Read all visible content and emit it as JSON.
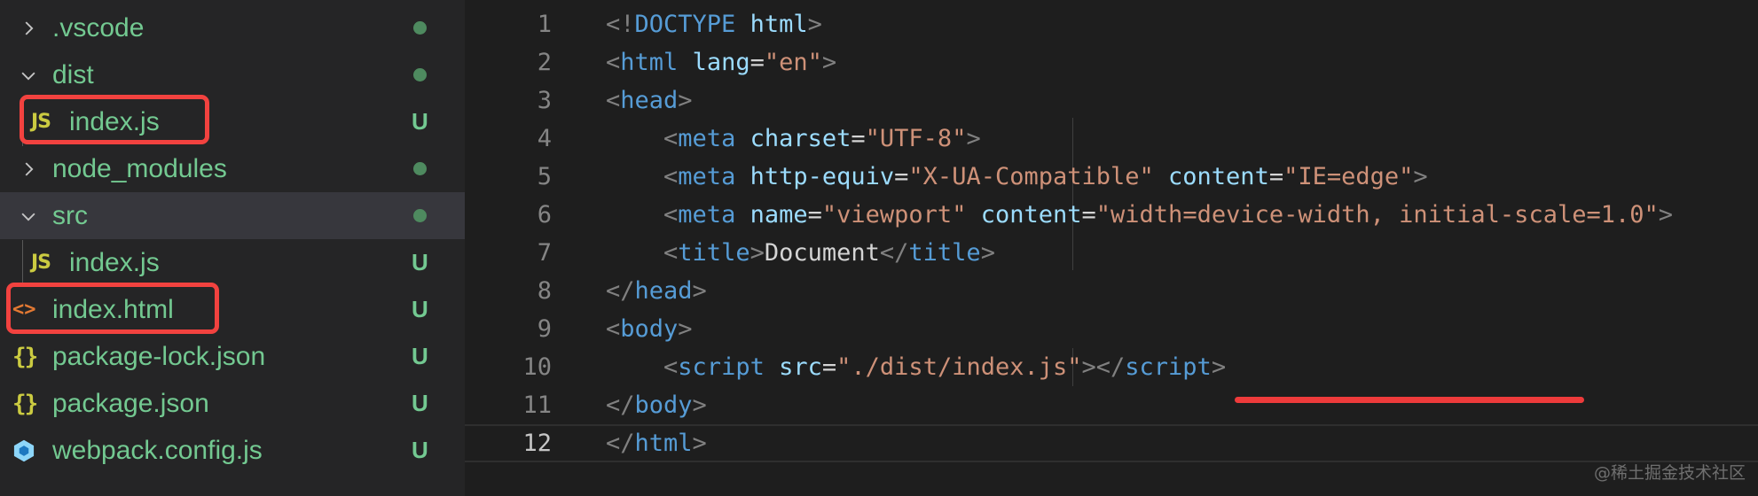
{
  "explorer": {
    "items": [
      {
        "label": ".vscode",
        "kind": "folder",
        "expanded": false,
        "badge": ""
      },
      {
        "label": "dist",
        "kind": "folder",
        "expanded": true,
        "badge": ""
      },
      {
        "label": "index.js",
        "kind": "js",
        "badge": "U"
      },
      {
        "label": "node_modules",
        "kind": "folder",
        "expanded": false,
        "badge": ""
      },
      {
        "label": "src",
        "kind": "folder",
        "expanded": true,
        "badge": ""
      },
      {
        "label": "index.js",
        "kind": "js",
        "badge": "U"
      },
      {
        "label": "index.html",
        "kind": "html",
        "badge": "U"
      },
      {
        "label": "package-lock.json",
        "kind": "json",
        "badge": "U"
      },
      {
        "label": "package.json",
        "kind": "json",
        "badge": "U"
      },
      {
        "label": "webpack.config.js",
        "kind": "webpack",
        "badge": "U"
      }
    ],
    "icons": {
      "js": "JS",
      "html": "<>",
      "json": "{}"
    }
  },
  "editor": {
    "line_numbers": [
      "1",
      "2",
      "3",
      "4",
      "5",
      "6",
      "7",
      "8",
      "9",
      "10",
      "11",
      "12"
    ],
    "current_line": "12",
    "lines": [
      [
        [
          "punc",
          "<!"
        ],
        [
          "tag",
          "DOCTYPE"
        ],
        [
          "text",
          " "
        ],
        [
          "attr",
          "html"
        ],
        [
          "punc",
          ">"
        ]
      ],
      [
        [
          "punc",
          "<"
        ],
        [
          "tag",
          "html"
        ],
        [
          "text",
          " "
        ],
        [
          "attr",
          "lang"
        ],
        [
          "text",
          "="
        ],
        [
          "str",
          "\"en\""
        ],
        [
          "punc",
          ">"
        ]
      ],
      [
        [
          "punc",
          "<"
        ],
        [
          "tag",
          "head"
        ],
        [
          "punc",
          ">"
        ]
      ],
      [
        [
          "text",
          "    "
        ],
        [
          "punc",
          "<"
        ],
        [
          "tag",
          "meta"
        ],
        [
          "text",
          " "
        ],
        [
          "attr",
          "charset"
        ],
        [
          "text",
          "="
        ],
        [
          "str",
          "\"UTF-8\""
        ],
        [
          "punc",
          ">"
        ]
      ],
      [
        [
          "text",
          "    "
        ],
        [
          "punc",
          "<"
        ],
        [
          "tag",
          "meta"
        ],
        [
          "text",
          " "
        ],
        [
          "attr",
          "http-equiv"
        ],
        [
          "text",
          "="
        ],
        [
          "str",
          "\"X-UA-Compatible\""
        ],
        [
          "text",
          " "
        ],
        [
          "attr",
          "content"
        ],
        [
          "text",
          "="
        ],
        [
          "str",
          "\"IE=edge\""
        ],
        [
          "punc",
          ">"
        ]
      ],
      [
        [
          "text",
          "    "
        ],
        [
          "punc",
          "<"
        ],
        [
          "tag",
          "meta"
        ],
        [
          "text",
          " "
        ],
        [
          "attr",
          "name"
        ],
        [
          "text",
          "="
        ],
        [
          "str",
          "\"viewport\""
        ],
        [
          "text",
          " "
        ],
        [
          "attr",
          "content"
        ],
        [
          "text",
          "="
        ],
        [
          "str",
          "\"width=device-width, initial-scale=1.0\""
        ],
        [
          "punc",
          ">"
        ]
      ],
      [
        [
          "text",
          "    "
        ],
        [
          "punc",
          "<"
        ],
        [
          "tag",
          "title"
        ],
        [
          "punc",
          ">"
        ],
        [
          "text",
          "Document"
        ],
        [
          "punc",
          "</"
        ],
        [
          "tag",
          "title"
        ],
        [
          "punc",
          ">"
        ]
      ],
      [
        [
          "punc",
          "</"
        ],
        [
          "tag",
          "head"
        ],
        [
          "punc",
          ">"
        ]
      ],
      [
        [
          "punc",
          "<"
        ],
        [
          "tag",
          "body"
        ],
        [
          "punc",
          ">"
        ]
      ],
      [
        [
          "text",
          "    "
        ],
        [
          "punc",
          "<"
        ],
        [
          "tag",
          "script"
        ],
        [
          "text",
          " "
        ],
        [
          "attr",
          "src"
        ],
        [
          "text",
          "="
        ],
        [
          "str",
          "\"./dist/index.js\""
        ],
        [
          "punc",
          "></"
        ],
        [
          "tag",
          "script"
        ],
        [
          "punc",
          ">"
        ]
      ],
      [
        [
          "punc",
          "</"
        ],
        [
          "tag",
          "body"
        ],
        [
          "punc",
          ">"
        ]
      ],
      [
        [
          "punc",
          "</"
        ],
        [
          "tag",
          "html"
        ],
        [
          "punc",
          ">"
        ]
      ]
    ]
  },
  "watermark": "@稀土掘金技术社区",
  "colors": {
    "highlight_box": "#f2423f",
    "untracked": "#73c991",
    "tag": "#569cd6",
    "attr": "#9cdcfe",
    "string": "#ce9178"
  }
}
